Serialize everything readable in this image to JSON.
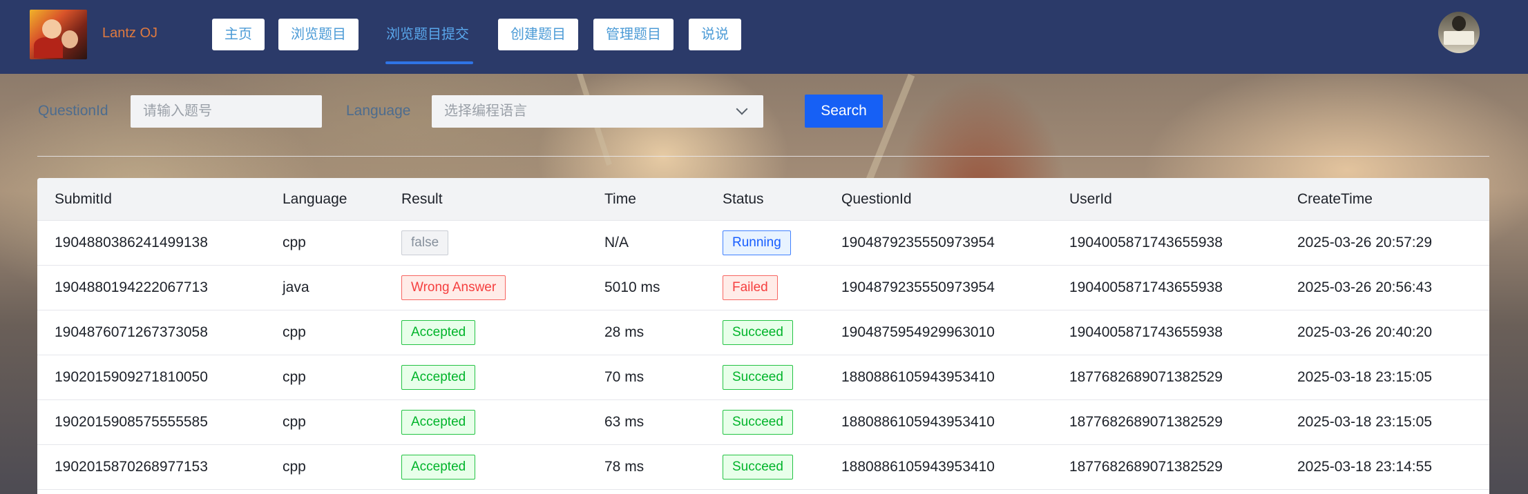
{
  "header": {
    "site_title": "Lantz OJ",
    "nav": [
      "主页",
      "浏览题目",
      "浏览题目提交",
      "创建题目",
      "管理题目",
      "说说"
    ],
    "active_nav": "浏览题目提交"
  },
  "search": {
    "question_label": "QuestionId",
    "question_placeholder": "请输入题号",
    "language_label": "Language",
    "language_placeholder": "选择编程语言",
    "button": "Search"
  },
  "table": {
    "columns": [
      "SubmitId",
      "Language",
      "Result",
      "Time",
      "Status",
      "QuestionId",
      "UserId",
      "CreateTime"
    ],
    "rows": [
      {
        "submit_id": "1904880386241499138",
        "language": "cpp",
        "result": "false",
        "time": "N/A",
        "status": "Running",
        "question_id": "1904879235550973954",
        "user_id": "1904005871743655938",
        "create_time": "2025-03-26 20:57:29"
      },
      {
        "submit_id": "1904880194222067713",
        "language": "java",
        "result": "Wrong Answer",
        "time": "5010 ms",
        "status": "Failed",
        "question_id": "1904879235550973954",
        "user_id": "1904005871743655938",
        "create_time": "2025-03-26 20:56:43"
      },
      {
        "submit_id": "1904876071267373058",
        "language": "cpp",
        "result": "Accepted",
        "time": "28 ms",
        "status": "Succeed",
        "question_id": "1904875954929963010",
        "user_id": "1904005871743655938",
        "create_time": "2025-03-26 20:40:20"
      },
      {
        "submit_id": "1902015909271810050",
        "language": "cpp",
        "result": "Accepted",
        "time": "70 ms",
        "status": "Succeed",
        "question_id": "1880886105943953410",
        "user_id": "1877682689071382529",
        "create_time": "2025-03-18 23:15:05"
      },
      {
        "submit_id": "1902015908575555585",
        "language": "cpp",
        "result": "Accepted",
        "time": "63 ms",
        "status": "Succeed",
        "question_id": "1880886105943953410",
        "user_id": "1877682689071382529",
        "create_time": "2025-03-18 23:15:05"
      },
      {
        "submit_id": "1902015870268977153",
        "language": "cpp",
        "result": "Accepted",
        "time": "78 ms",
        "status": "Succeed",
        "question_id": "1880886105943953410",
        "user_id": "1877682689071382529",
        "create_time": "2025-03-18 23:14:55"
      }
    ]
  },
  "colors": {
    "header_bg": "#2b3a69",
    "primary": "#1660f5",
    "success": "#00b42a",
    "danger": "#f53f3f",
    "info": "#165dff"
  }
}
